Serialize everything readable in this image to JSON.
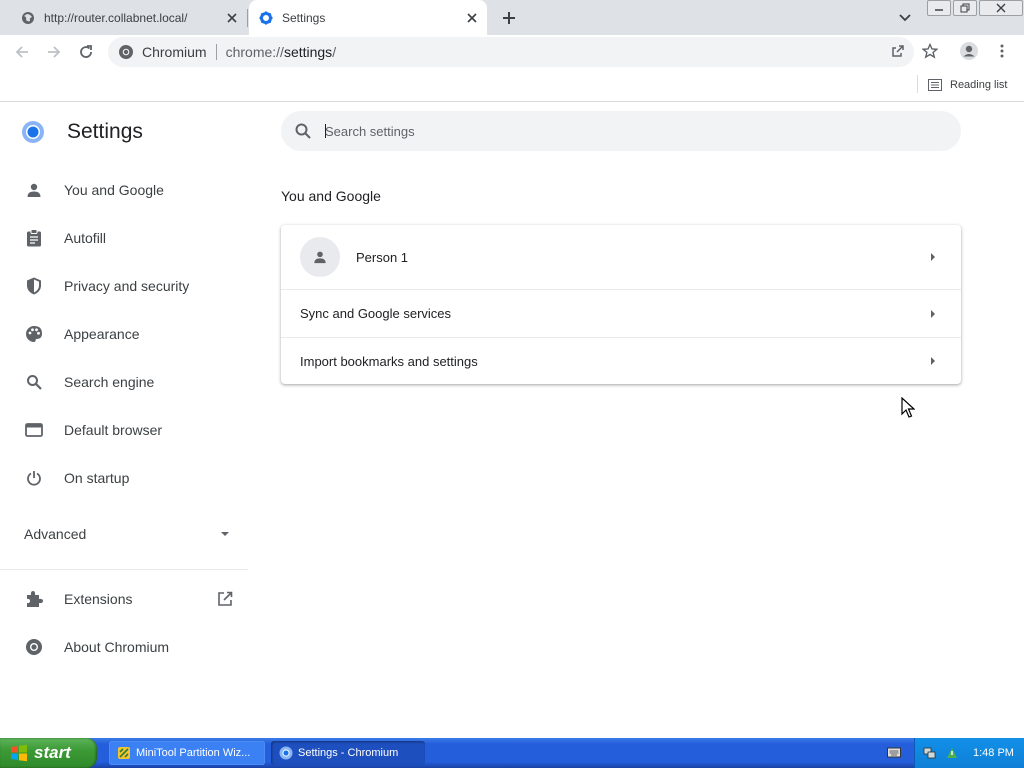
{
  "tabs": [
    {
      "title": "http://router.collabnet.local/",
      "icon": "globe-icon",
      "active": false
    },
    {
      "title": "Settings",
      "icon": "gear-icon",
      "active": true
    }
  ],
  "toolbar": {
    "chip_label": "Chromium",
    "url_prefix": "chrome://",
    "url_host": "settings",
    "url_suffix": "/"
  },
  "bookmarks": {
    "reading_list": "Reading list"
  },
  "settings": {
    "title": "Settings",
    "search_placeholder": "Search settings",
    "nav": [
      {
        "label": "You and Google",
        "icon": "person-icon"
      },
      {
        "label": "Autofill",
        "icon": "clipboard-icon"
      },
      {
        "label": "Privacy and security",
        "icon": "shield-icon"
      },
      {
        "label": "Appearance",
        "icon": "palette-icon"
      },
      {
        "label": "Search engine",
        "icon": "search-icon"
      },
      {
        "label": "Default browser",
        "icon": "browser-icon"
      },
      {
        "label": "On startup",
        "icon": "power-icon"
      }
    ],
    "advanced": "Advanced",
    "extensions": "Extensions",
    "about": "About Chromium",
    "section_title": "You and Google",
    "rows": [
      "Person 1",
      "Sync and Google services",
      "Import bookmarks and settings"
    ]
  },
  "taskbar": {
    "start": "start",
    "items": [
      "MiniTool Partition Wiz...",
      "Settings - Chromium"
    ],
    "time": "1:48 PM"
  },
  "colors": {
    "accent": "#1a73e8",
    "taskbar": "#245edb",
    "start": "#3c9a36"
  }
}
